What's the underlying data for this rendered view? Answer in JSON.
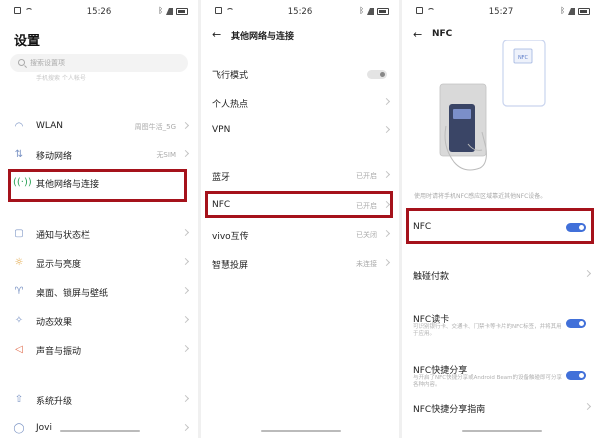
{
  "status": {
    "time_1": "15:26",
    "time_2": "15:26",
    "time_3": "15:27"
  },
  "settings": {
    "title": "设置",
    "search_placeholder": "搜索设置项",
    "faint_text": "手机搜索  个人帐号",
    "items": [
      {
        "label": "WLAN",
        "value": "周图牛活_5G",
        "icon": "wifi-icon"
      },
      {
        "label": "移动网络",
        "value": "无SIM",
        "icon": "signal-icon"
      },
      {
        "label": "其他网络与连接",
        "value": "",
        "icon": "nfc-waves-icon"
      },
      {
        "label": "通知与状态栏",
        "value": "",
        "icon": "notification-icon"
      },
      {
        "label": "显示与亮度",
        "value": "",
        "icon": "sun-icon"
      },
      {
        "label": "桌面、锁屏与壁纸",
        "value": "",
        "icon": "shirt-icon"
      },
      {
        "label": "动态效果",
        "value": "",
        "icon": "motion-icon"
      },
      {
        "label": "声音与振动",
        "value": "",
        "icon": "speaker-icon"
      },
      {
        "label": "系统升级",
        "value": "",
        "icon": "upgrade-icon"
      },
      {
        "label": "Jovi",
        "value": "",
        "icon": "jovi-icon"
      }
    ]
  },
  "other_networks": {
    "title": "其他网络与连接",
    "items": [
      {
        "label": "飞行模式",
        "value": ""
      },
      {
        "label": "个人热点",
        "value": ""
      },
      {
        "label": "VPN",
        "value": ""
      },
      {
        "label": "蓝牙",
        "value": "已开启"
      },
      {
        "label": "NFC",
        "value": "已开启"
      },
      {
        "label": "vivo互传",
        "value": "已关闭"
      },
      {
        "label": "智慧投屏",
        "value": "未连接"
      }
    ]
  },
  "nfc": {
    "title": "NFC",
    "illustration_label": "NFC",
    "description": "使用时请将手机NFC感应区域靠近其他NFC设备。",
    "nfc_label": "NFC",
    "tap_pay": "触碰付款",
    "reader_label": "NFC读卡",
    "reader_sub": "可识别银行卡、交通卡、门禁卡等卡片的NFC标签，并将其用于应用。",
    "quick_share": "NFC快捷分享",
    "quick_share_sub": "与开启了NFC快捷分享或Android Beam的设备触碰即可分享各种内容。",
    "guide": "NFC快捷分享指南"
  },
  "colors": {
    "accent": "#4170d9",
    "highlight": "#a5121b"
  }
}
